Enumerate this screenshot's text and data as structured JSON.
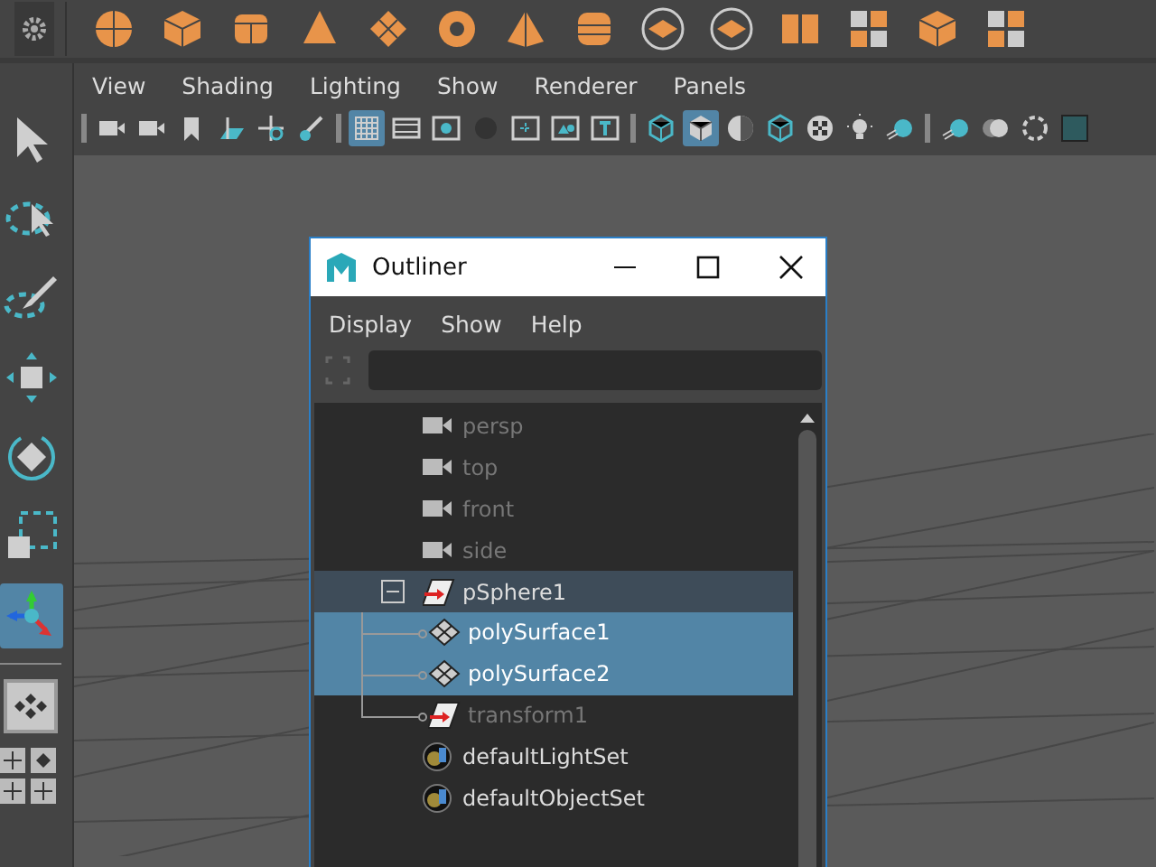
{
  "shelf": [
    {
      "kind": "sphere"
    },
    {
      "kind": "cube"
    },
    {
      "kind": "cylinder"
    },
    {
      "kind": "cone"
    },
    {
      "kind": "plane"
    },
    {
      "kind": "torus"
    },
    {
      "kind": "pyramid"
    },
    {
      "kind": "pipe"
    },
    {
      "kind": "layers"
    },
    {
      "kind": "layers"
    },
    {
      "kind": "split"
    },
    {
      "kind": "grid"
    },
    {
      "kind": "cube"
    },
    {
      "kind": "grid"
    }
  ],
  "toolbox": [
    {
      "kind": "select",
      "selected": false
    },
    {
      "kind": "lasso",
      "selected": false
    },
    {
      "kind": "paint",
      "selected": false
    },
    {
      "kind": "move",
      "selected": false
    },
    {
      "kind": "rotate",
      "selected": false
    },
    {
      "kind": "scale",
      "selected": false
    },
    {
      "kind": "axes",
      "selected": true
    }
  ],
  "panel_menu": [
    "View",
    "Shading",
    "Lighting",
    "Show",
    "Renderer",
    "Panels"
  ],
  "panel_toolbar": [
    [
      {
        "kind": "camera",
        "selected": false
      },
      {
        "kind": "camera",
        "selected": false
      },
      {
        "kind": "bookmark",
        "selected": false
      },
      {
        "kind": "plane",
        "selected": false
      },
      {
        "kind": "target",
        "selected": false
      },
      {
        "kind": "brush",
        "selected": false
      }
    ],
    [
      {
        "kind": "grid",
        "selected": true
      },
      {
        "kind": "film",
        "selected": false
      },
      {
        "kind": "dot",
        "selected": false
      },
      {
        "kind": "circle",
        "selected": false
      },
      {
        "kind": "safe",
        "selected": false
      },
      {
        "kind": "image",
        "selected": false
      },
      {
        "kind": "text",
        "selected": false
      }
    ],
    [
      {
        "kind": "wirecube",
        "selected": false
      },
      {
        "kind": "cube",
        "selected": true
      },
      {
        "kind": "half",
        "selected": false
      },
      {
        "kind": "wirecube",
        "selected": false
      },
      {
        "kind": "checker",
        "selected": false
      },
      {
        "kind": "light",
        "selected": false
      },
      {
        "kind": "ball",
        "selected": false
      }
    ],
    [
      {
        "kind": "ball",
        "selected": false
      },
      {
        "kind": "ghost",
        "selected": false
      },
      {
        "kind": "ring",
        "selected": false
      },
      {
        "kind": "square",
        "selected": false
      }
    ]
  ],
  "outliner": {
    "title": "Outliner",
    "menu": [
      "Display",
      "Show",
      "Help"
    ],
    "tree": [
      {
        "label": "persp",
        "kind": "camera",
        "dimmed": true,
        "selected": false
      },
      {
        "label": "top",
        "kind": "camera",
        "dimmed": true,
        "selected": false
      },
      {
        "label": "front",
        "kind": "camera",
        "dimmed": true,
        "selected": false
      },
      {
        "label": "side",
        "kind": "camera",
        "dimmed": true,
        "selected": false
      },
      {
        "label": "pSphere1",
        "kind": "transform",
        "dimmed": false,
        "selected": false,
        "expanded": true,
        "children": [
          {
            "label": "polySurface1",
            "kind": "mesh",
            "dimmed": false,
            "selected": true
          },
          {
            "label": "polySurface2",
            "kind": "mesh",
            "dimmed": false,
            "selected": true
          },
          {
            "label": "transform1",
            "kind": "transform",
            "dimmed": true,
            "selected": false
          }
        ]
      },
      {
        "label": "defaultLightSet",
        "kind": "set",
        "dimmed": false,
        "selected": false
      },
      {
        "label": "defaultObjectSet",
        "kind": "set",
        "dimmed": false,
        "selected": false
      }
    ]
  }
}
